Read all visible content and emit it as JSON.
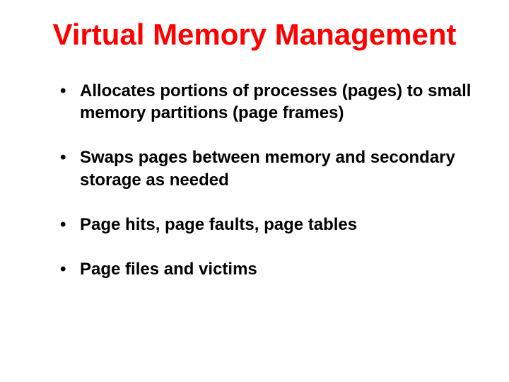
{
  "title": "Virtual Memory Management",
  "bullets": [
    "Allocates portions of processes (pages) to small memory partitions (page frames)",
    "Swaps pages between memory and secondary storage as needed",
    "Page hits, page faults, page tables",
    "Page files and victims"
  ]
}
